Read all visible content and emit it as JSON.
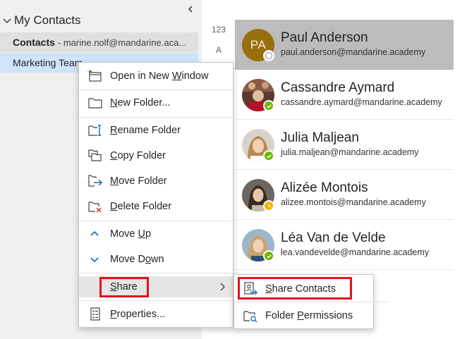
{
  "folder_pane": {
    "section_title": "My Contacts",
    "folders": [
      {
        "name": "Contacts",
        "account": "- marine.nolf@mandarine.aca..."
      },
      {
        "name": "Marketing Team"
      }
    ]
  },
  "index_letters": [
    "123",
    "A"
  ],
  "contacts": [
    {
      "name": "Paul Anderson",
      "email": "paul.anderson@mandarine.academy",
      "initials": "PA",
      "presence": "offline",
      "selected": true
    },
    {
      "name": "Cassandre Aymard",
      "email": "cassandre.aymard@mandarine.academy",
      "presence": "available"
    },
    {
      "name": "Julia Maljean",
      "email": "julia.maljean@mandarine.academy",
      "presence": "available"
    },
    {
      "name": "Alizée Montois",
      "email": "alizee.montois@mandarine.academy",
      "presence": "away"
    },
    {
      "name": "Léa Van de Velde",
      "email": "lea.vandevelde@mandarine.academy",
      "presence": "available"
    }
  ],
  "context_menu": {
    "open_new_window": {
      "pre": "Open in New ",
      "key": "W",
      "post": "indow"
    },
    "new_folder": {
      "pre": "",
      "key": "N",
      "post": "ew Folder..."
    },
    "rename_folder": {
      "pre": "",
      "key": "R",
      "post": "ename Folder"
    },
    "copy_folder": {
      "pre": "",
      "key": "C",
      "post": "opy Folder"
    },
    "move_folder": {
      "pre": "",
      "key": "M",
      "post": "ove Folder"
    },
    "delete_folder": {
      "pre": "",
      "key": "D",
      "post": "elete Folder"
    },
    "move_up": {
      "pre": "Move ",
      "key": "U",
      "post": "p"
    },
    "move_down": {
      "pre": "Move D",
      "key": "o",
      "post": "wn"
    },
    "share": {
      "pre": "",
      "key": "S",
      "post": "hare"
    },
    "properties": {
      "pre": "",
      "key": "P",
      "post": "roperties..."
    }
  },
  "share_submenu": {
    "share_contacts": {
      "pre": "",
      "key": "S",
      "post": "hare Contacts"
    },
    "folder_permissions": {
      "pre": "Folder ",
      "key": "P",
      "post": "ermissions"
    }
  },
  "colors": {
    "highlight": "#e0141e",
    "available": "#6bb700",
    "away": "#f8b300",
    "selected_row": "#bcbcbc",
    "selected_folder": "#cfe4fa",
    "icon_blue": "#0f6cbd"
  }
}
